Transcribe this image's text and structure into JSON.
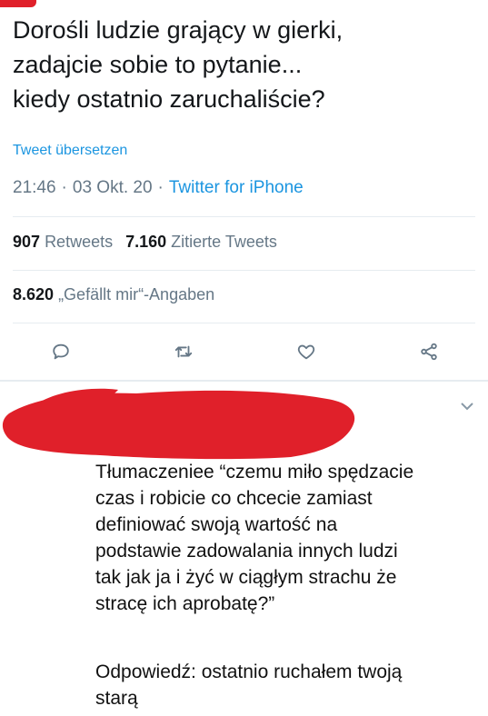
{
  "tweet": {
    "text": "Dorośli ludzie grający w gierki,\nzadajcie sobie to pytanie...\nkiedy ostatnio zaruchaliście?",
    "translate_label": "Tweet übersetzen",
    "time": "21:46",
    "date": "03 Okt. 20",
    "source": "Twitter for iPhone",
    "separator": "·"
  },
  "stats": {
    "retweets_count": "907",
    "retweets_label": "Retweets",
    "quotes_count": "7.160",
    "quotes_label": "Zitierte Tweets",
    "likes_count": "8.620",
    "likes_label": "„Gefällt mir“-Angaben"
  },
  "actions": [
    {
      "name": "reply",
      "icon": "reply-icon"
    },
    {
      "name": "retweet",
      "icon": "retweet-icon"
    },
    {
      "name": "like",
      "icon": "heart-icon"
    },
    {
      "name": "share",
      "icon": "share-icon"
    }
  ],
  "reply": {
    "text": "Tłumaczeniee “czemu miło spędzacie\nczas i robicie co chcecie zamiast\ndefiniować swoją wartość na\npodstawie zadowalania innych ludzi\ntak jak ja i żyć w ciągłym strachu że\nstracę ich aprobatę?”",
    "answer": "Odpowiedź: ostatnio ruchałem twoją stara",
    "answer_line1": "Odpowiedź: ostatnio ruchałem twoją",
    "answer_line2": "starą"
  },
  "colors": {
    "link": "#1b95e0",
    "muted": "#657786",
    "redaction": "#e0202a",
    "divider": "#e6ecf0"
  }
}
